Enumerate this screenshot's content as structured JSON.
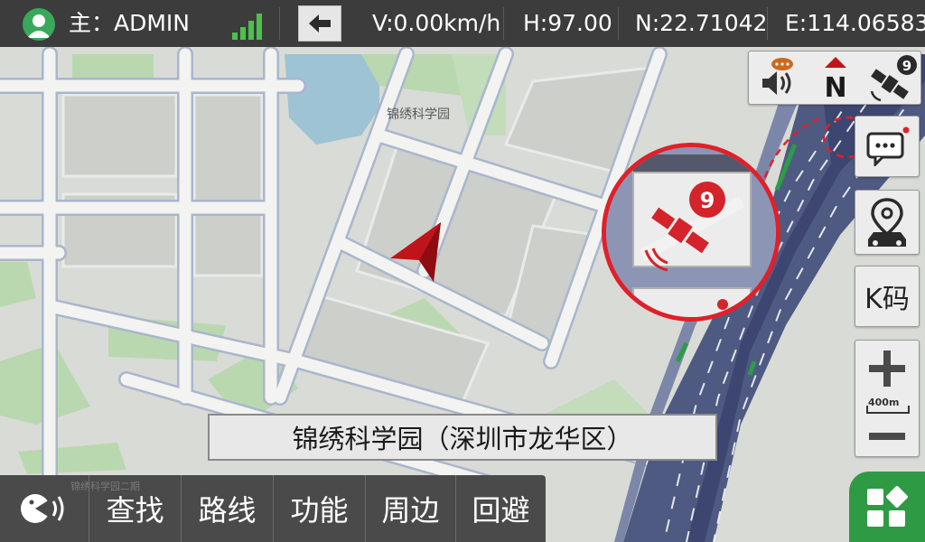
{
  "topbar": {
    "user_label": "主：ADMIN",
    "speed": "V:0.00km/h",
    "heading": "H:97.00",
    "latitude": "N:22.71042",
    "longitude": "E:114.06583",
    "icons": {
      "user": "user-avatar-icon",
      "signal": "signal-strength-icon",
      "back": "back-arrow-icon"
    }
  },
  "map": {
    "poi_label": "锦绣科学园",
    "vehicle_icon": "vehicle-position-arrow-icon",
    "colors": {
      "land": "#d9dbd6",
      "block": "#cfd1cc",
      "road": "#f3f3f1",
      "road_edge": "#aab6cc",
      "green": "#b9d8b0",
      "water": "#9ec3d4",
      "highway": "#4f5a82",
      "arrow": "#c0141b"
    }
  },
  "top_toolbar": {
    "voice_icon": "voice-broadcast-icon",
    "north_label": "N",
    "north_icon": "north-up-compass-icon",
    "satellite_count": "9",
    "satellite_icon": "gps-satellite-icon"
  },
  "side_buttons": {
    "message_icon": "message-bubble-icon",
    "location_icon": "vehicle-location-icon",
    "k_code_label": "K码"
  },
  "zoom": {
    "scale": "400m",
    "in_icon": "zoom-in-icon",
    "out_icon": "zoom-out-icon"
  },
  "magnifier": {
    "satellite_count": "9"
  },
  "place_banner": {
    "text": "锦绣科学园（深圳市龙华区）"
  },
  "bottombar": {
    "sub_label": "锦绣科学园二期",
    "voice_icon": "voice-assistant-icon",
    "buttons": [
      "查找",
      "路线",
      "功能",
      "周边",
      "回避"
    ]
  },
  "menu": {
    "icon": "grid-menu-icon"
  }
}
